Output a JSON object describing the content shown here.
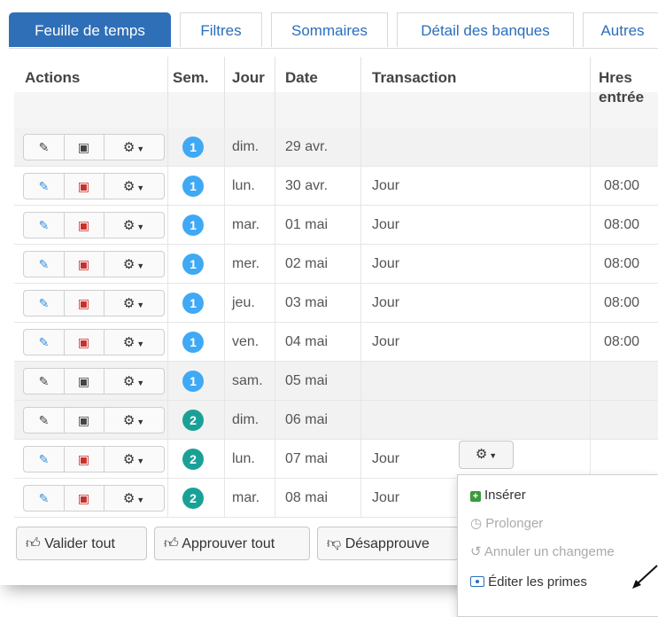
{
  "tabs": [
    {
      "label": "Feuille de temps",
      "active": true
    },
    {
      "label": "Filtres"
    },
    {
      "label": "Sommaires"
    },
    {
      "label": "Détail des banques"
    },
    {
      "label": "Autres"
    }
  ],
  "columns": {
    "actions": "Actions",
    "sem": "Sem.",
    "jour": "Jour",
    "date": "Date",
    "transaction": "Transaction",
    "hres_line1": "Hres",
    "hres_line2": "entrée"
  },
  "rows": [
    {
      "sem": "1",
      "jour": "dim.",
      "date": "29 avr.",
      "transaction": "",
      "hres": "",
      "weekend": true
    },
    {
      "sem": "1",
      "jour": "lun.",
      "date": "30 avr.",
      "transaction": "Jour",
      "hres": "08:00"
    },
    {
      "sem": "1",
      "jour": "mar.",
      "date": "01 mai",
      "transaction": "Jour",
      "hres": "08:00"
    },
    {
      "sem": "1",
      "jour": "mer.",
      "date": "02 mai",
      "transaction": "Jour",
      "hres": "08:00"
    },
    {
      "sem": "1",
      "jour": "jeu.",
      "date": "03 mai",
      "transaction": "Jour",
      "hres": "08:00"
    },
    {
      "sem": "1",
      "jour": "ven.",
      "date": "04 mai",
      "transaction": "Jour",
      "hres": "08:00"
    },
    {
      "sem": "1",
      "jour": "sam.",
      "date": "05 mai",
      "transaction": "",
      "hres": "",
      "weekend": true
    },
    {
      "sem": "2",
      "jour": "dim.",
      "date": "06 mai",
      "transaction": "",
      "hres": "",
      "weekend": true
    },
    {
      "sem": "2",
      "jour": "lun.",
      "date": "07 mai",
      "transaction": "Jour",
      "hres": ""
    },
    {
      "sem": "2",
      "jour": "mar.",
      "date": "08 mai",
      "transaction": "Jour",
      "hres": ""
    }
  ],
  "bottom_buttons": {
    "validate_all": "Valider tout",
    "approve_all": "Approuver tout",
    "disapprove_all": "Désapprouve"
  },
  "menu": {
    "insert": "Insérer",
    "extend": "Prolonger",
    "cancel_change": "Annuler un changeme",
    "edit_bonuses": "Éditer les primes"
  },
  "colors": {
    "tab_active": "#2f6fb7",
    "badge_week1": "#3fa9f5",
    "badge_week2": "#1aa197",
    "edit_icon": "#3b8fd9",
    "trash_icon": "#c9302c"
  },
  "icons": {
    "edit": "pencil-square-icon",
    "trash": "trash-icon",
    "gear": "gear-icon",
    "thumbs_up": "thumbs-up-icon",
    "thumbs_down": "thumbs-down-icon"
  }
}
